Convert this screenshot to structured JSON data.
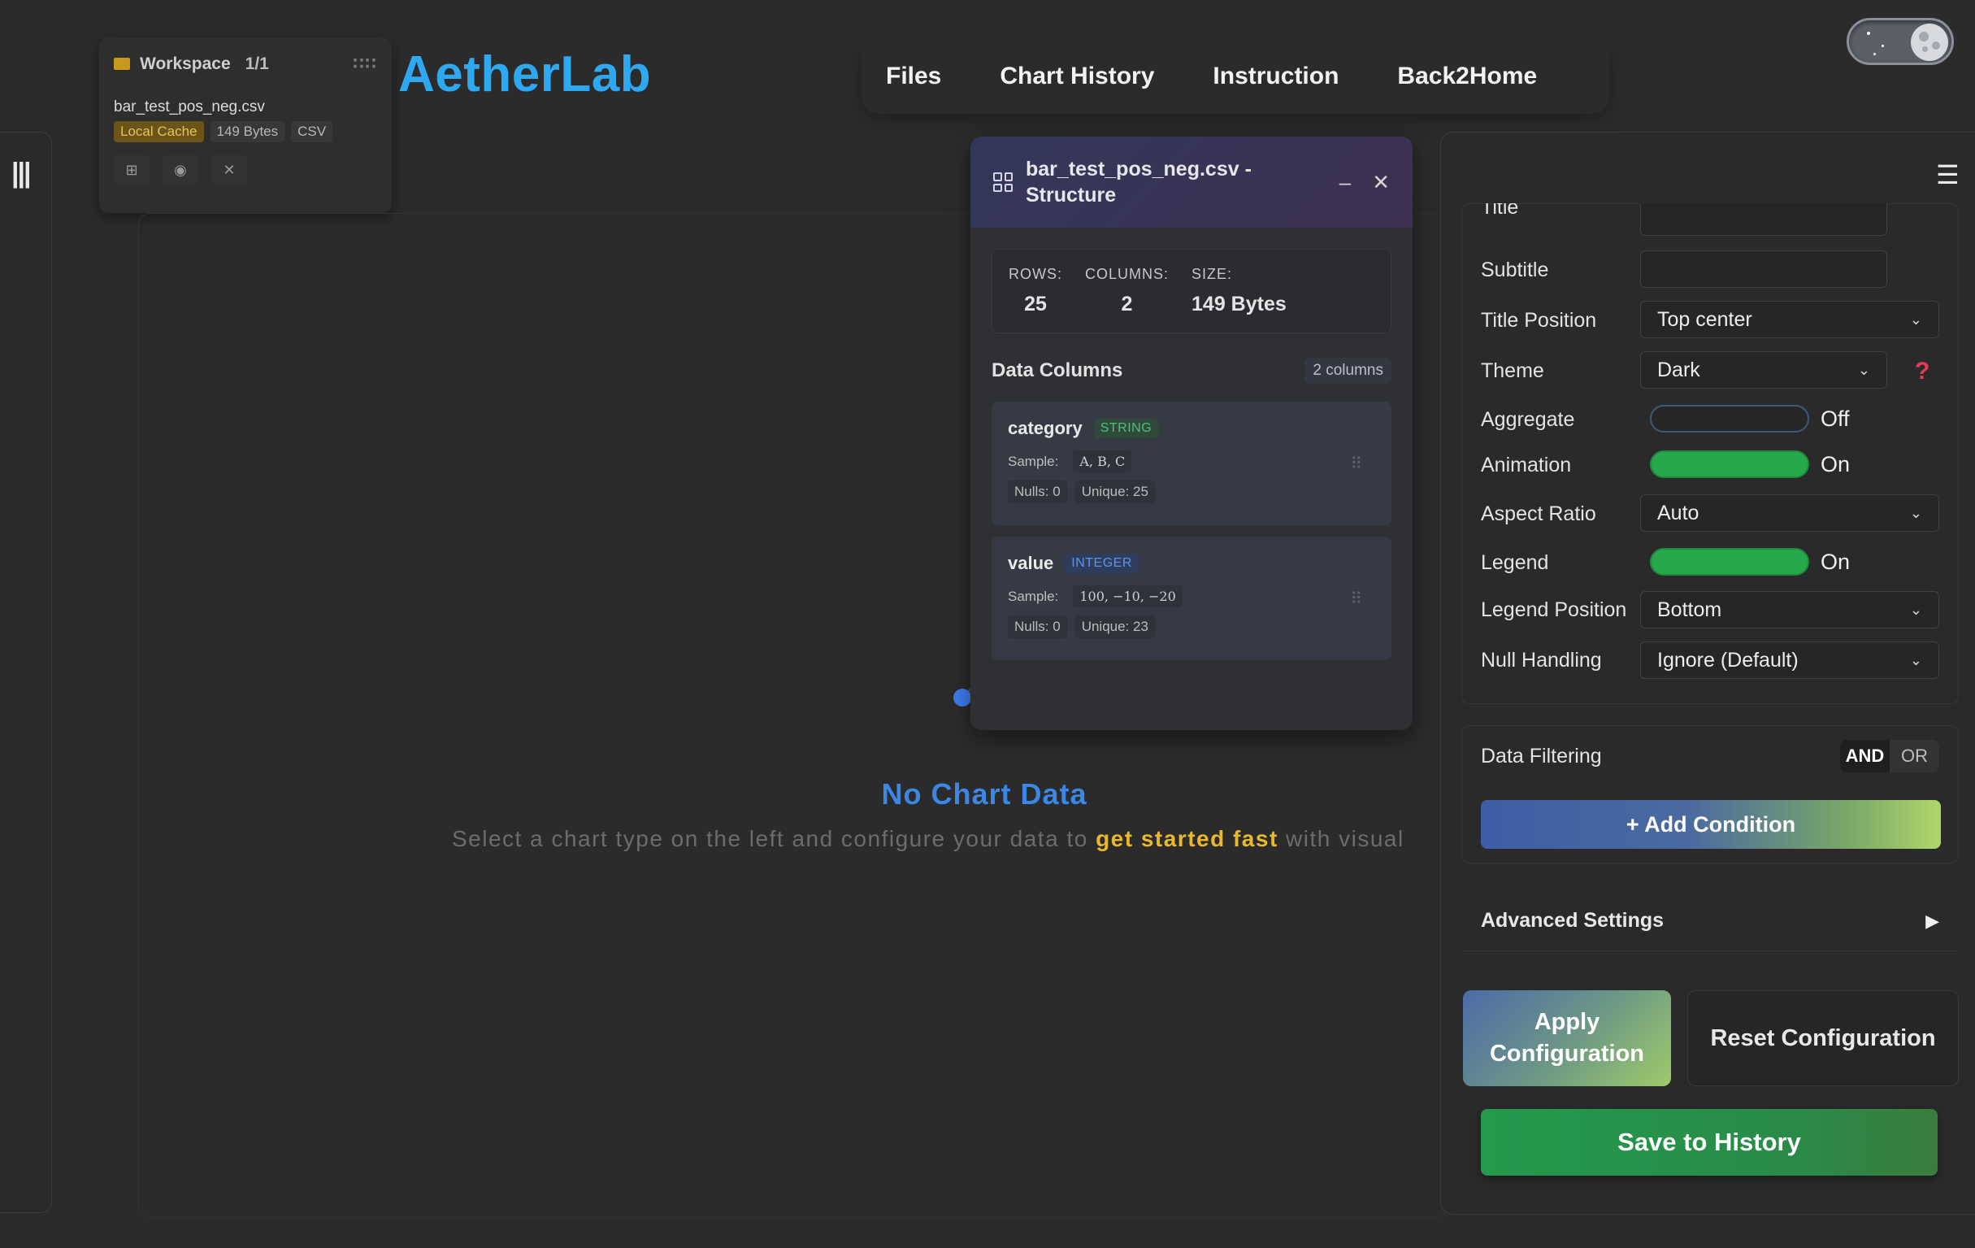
{
  "app": {
    "brand": "AetherLab"
  },
  "nav": {
    "items": [
      "Files",
      "Chart History",
      "Instruction",
      "Back2Home"
    ]
  },
  "workspace": {
    "title": "Workspace",
    "count": "1/1",
    "file": {
      "name": "bar_test_pos_neg.csv",
      "tags": [
        "Local Cache",
        "149 Bytes",
        "CSV"
      ]
    },
    "icons": [
      "grid-icon",
      "eye-icon",
      "close-icon"
    ]
  },
  "empty_state": {
    "title": "No Chart Data",
    "subtitle_before": "Select a chart type on the left and configure your data to ",
    "subtitle_highlight": "get started fast",
    "subtitle_after": " with visual"
  },
  "structure": {
    "title": "bar_test_pos_neg.csv - Structure",
    "stats": [
      {
        "label": "ROWS:",
        "value": "25"
      },
      {
        "label": "COLUMNS:",
        "value": "2"
      },
      {
        "label": "SIZE:",
        "value": "149 Bytes"
      }
    ],
    "data_columns_label": "Data Columns",
    "columns_badge": "2 columns",
    "columns": [
      {
        "name": "category",
        "type": "STRING",
        "sample_label": "Sample:",
        "samples": "A,  B,  C",
        "nulls": "Nulls: 0",
        "unique": "Unique: 25"
      },
      {
        "name": "value",
        "type": "INTEGER",
        "sample_label": "Sample:",
        "samples": "100,  −10,  −20",
        "nulls": "Nulls: 0",
        "unique": "Unique: 23"
      }
    ]
  },
  "config": {
    "fields": {
      "title_label": "Title",
      "subtitle_label": "Subtitle",
      "title_position_label": "Title Position",
      "title_position_value": "Top center",
      "theme_label": "Theme",
      "theme_value": "Dark",
      "aggregate_label": "Aggregate",
      "aggregate_state": "Off",
      "animation_label": "Animation",
      "animation_state": "On",
      "aspect_ratio_label": "Aspect Ratio",
      "aspect_ratio_value": "Auto",
      "legend_label": "Legend",
      "legend_state": "On",
      "legend_position_label": "Legend Position",
      "legend_position_value": "Bottom",
      "null_handling_label": "Null Handling",
      "null_handling_value": "Ignore (Default)"
    },
    "filtering": {
      "label": "Data Filtering",
      "and": "AND",
      "or": "OR",
      "add_condition": "+ Add Condition"
    },
    "advanced_label": "Advanced Settings",
    "apply_label": "Apply Configuration",
    "reset_label": "Reset Configuration",
    "save_label": "Save to History"
  }
}
